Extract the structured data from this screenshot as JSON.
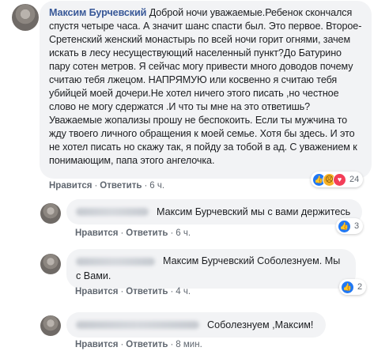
{
  "main_comment": {
    "author": "Максим Бурчевский",
    "text": "Доброй ночи уважаемые.Ребенок скончался спустя четыре часа. А значит шанс спасти был. Это первое. Второе- Сретенский женский монастырь по всей ночи горит огнями, зачем искать в лесу несуществующий населенный пункт?До Батурино пару сотен метров. Я сейчас могу привести много доводов почему считаю тебя лжецом. НАПРЯМУЮ или косвенно я считаю тебя убийцей моей дочери.Не хотел ничего этого писать ,но честное слово не могу сдержатся .И что ты мне на это ответишь? Уважаемые жопализы прошу не беспокоить. Если ты мужчина то жду твоего личного обращения к моей семье. Хотя бы здесь. И это не хотел писать но скажу так, я пойду за тобой в ад. С уважением к понимающим, папа этого ангелочка.",
    "like_label": "Нравится",
    "reply_label": "Ответить",
    "time": "6 ч.",
    "reactions": {
      "icons": [
        "like-icon",
        "sad-icon",
        "love-icon"
      ],
      "count": "24"
    }
  },
  "replies": [
    {
      "text": "Максим Бурчевский мы с вами держитесь",
      "like_label": "Нравится",
      "reply_label": "Ответить",
      "time": "6 ч.",
      "reactions": {
        "icons": [
          "like-icon"
        ],
        "count": "3"
      }
    },
    {
      "text": "Максим Бурчевский Соболезнуем. Мы с Вами.",
      "like_label": "Нравится",
      "reply_label": "Ответить",
      "time": "4 ч.",
      "reactions": {
        "icons": [
          "like-icon"
        ],
        "count": "2"
      }
    },
    {
      "text": "Соболезнуем ,Максим!",
      "like_label": "Нравится",
      "reply_label": "Ответить",
      "time": "8 мин."
    }
  ],
  "separator": "·",
  "colors": {
    "author_link": "#385898",
    "bubble": "#f2f3f5",
    "meta": "#606770",
    "like": "#2078f4",
    "love": "#f33e58",
    "sad": "#f7b125"
  }
}
